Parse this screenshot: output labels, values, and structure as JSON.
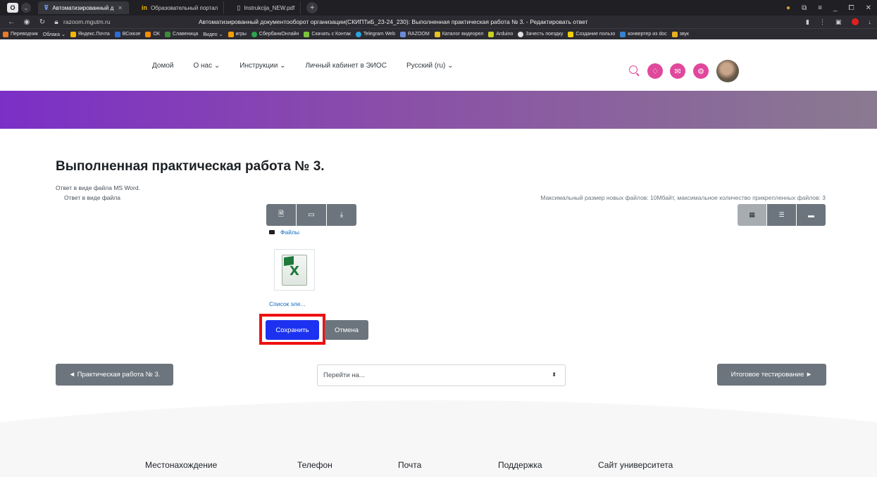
{
  "browser": {
    "tabs": [
      {
        "label": "Автоматизированный д",
        "active": true
      },
      {
        "label": "Образовательный портал",
        "active": false
      },
      {
        "label": "Instrukcija_NEW.pdf",
        "active": false
      }
    ],
    "url": "razoom.mgutm.ru",
    "page_title": "Автоматизированный документооборот организации(СКИПТиБ_23-24_230): Выполненная практическая работа № 3. - Редактировать ответ",
    "bookmarks": [
      "Переводчик",
      "Облака ⌄",
      "Яндекс.Почта",
      "ВСоюзе",
      "ОК",
      "Славеница",
      "Видео ⌄",
      "игры",
      "СбербанкОнлайн",
      "Скачать с Контак",
      "Telegram Web",
      "RAZOOM",
      "Каталог видеорел",
      "Arduino",
      "Зачесть поездку",
      "Создание пользо",
      "конвертер из doc",
      "звук"
    ]
  },
  "nav": {
    "items": [
      "Домой",
      "О нас ⌄",
      "Инструкции ⌄",
      "Личный кабинет в ЭИОС",
      "Русский (ru) ⌄"
    ]
  },
  "main": {
    "title": "Выполненная практическая работа № 3.",
    "description": "Ответ в виде файла MS Word.",
    "file_label": "Ответ в виде файла",
    "max_info": "Максимальный размер новых файлов: 10Мбайт, максимальное количество прикрепленных файлов: 3",
    "breadcrumb": "Файлы",
    "file_name": "Список эле...",
    "save_label": "Сохранить",
    "cancel_label": "Отмена"
  },
  "pagination": {
    "prev_label": "◄ Практическая работа № 3.",
    "jump_placeholder": "Перейти на...",
    "next_label": "Итоговое тестирование ►"
  },
  "footer": {
    "links": [
      "Местонахождение",
      "Телефон",
      "Почта",
      "Поддержка",
      "Сайт университета"
    ]
  },
  "colors": {
    "accent": "#e0489c",
    "primary": "#1c32f0",
    "highlight": "#ee1010",
    "secondary": "#6c757d"
  }
}
